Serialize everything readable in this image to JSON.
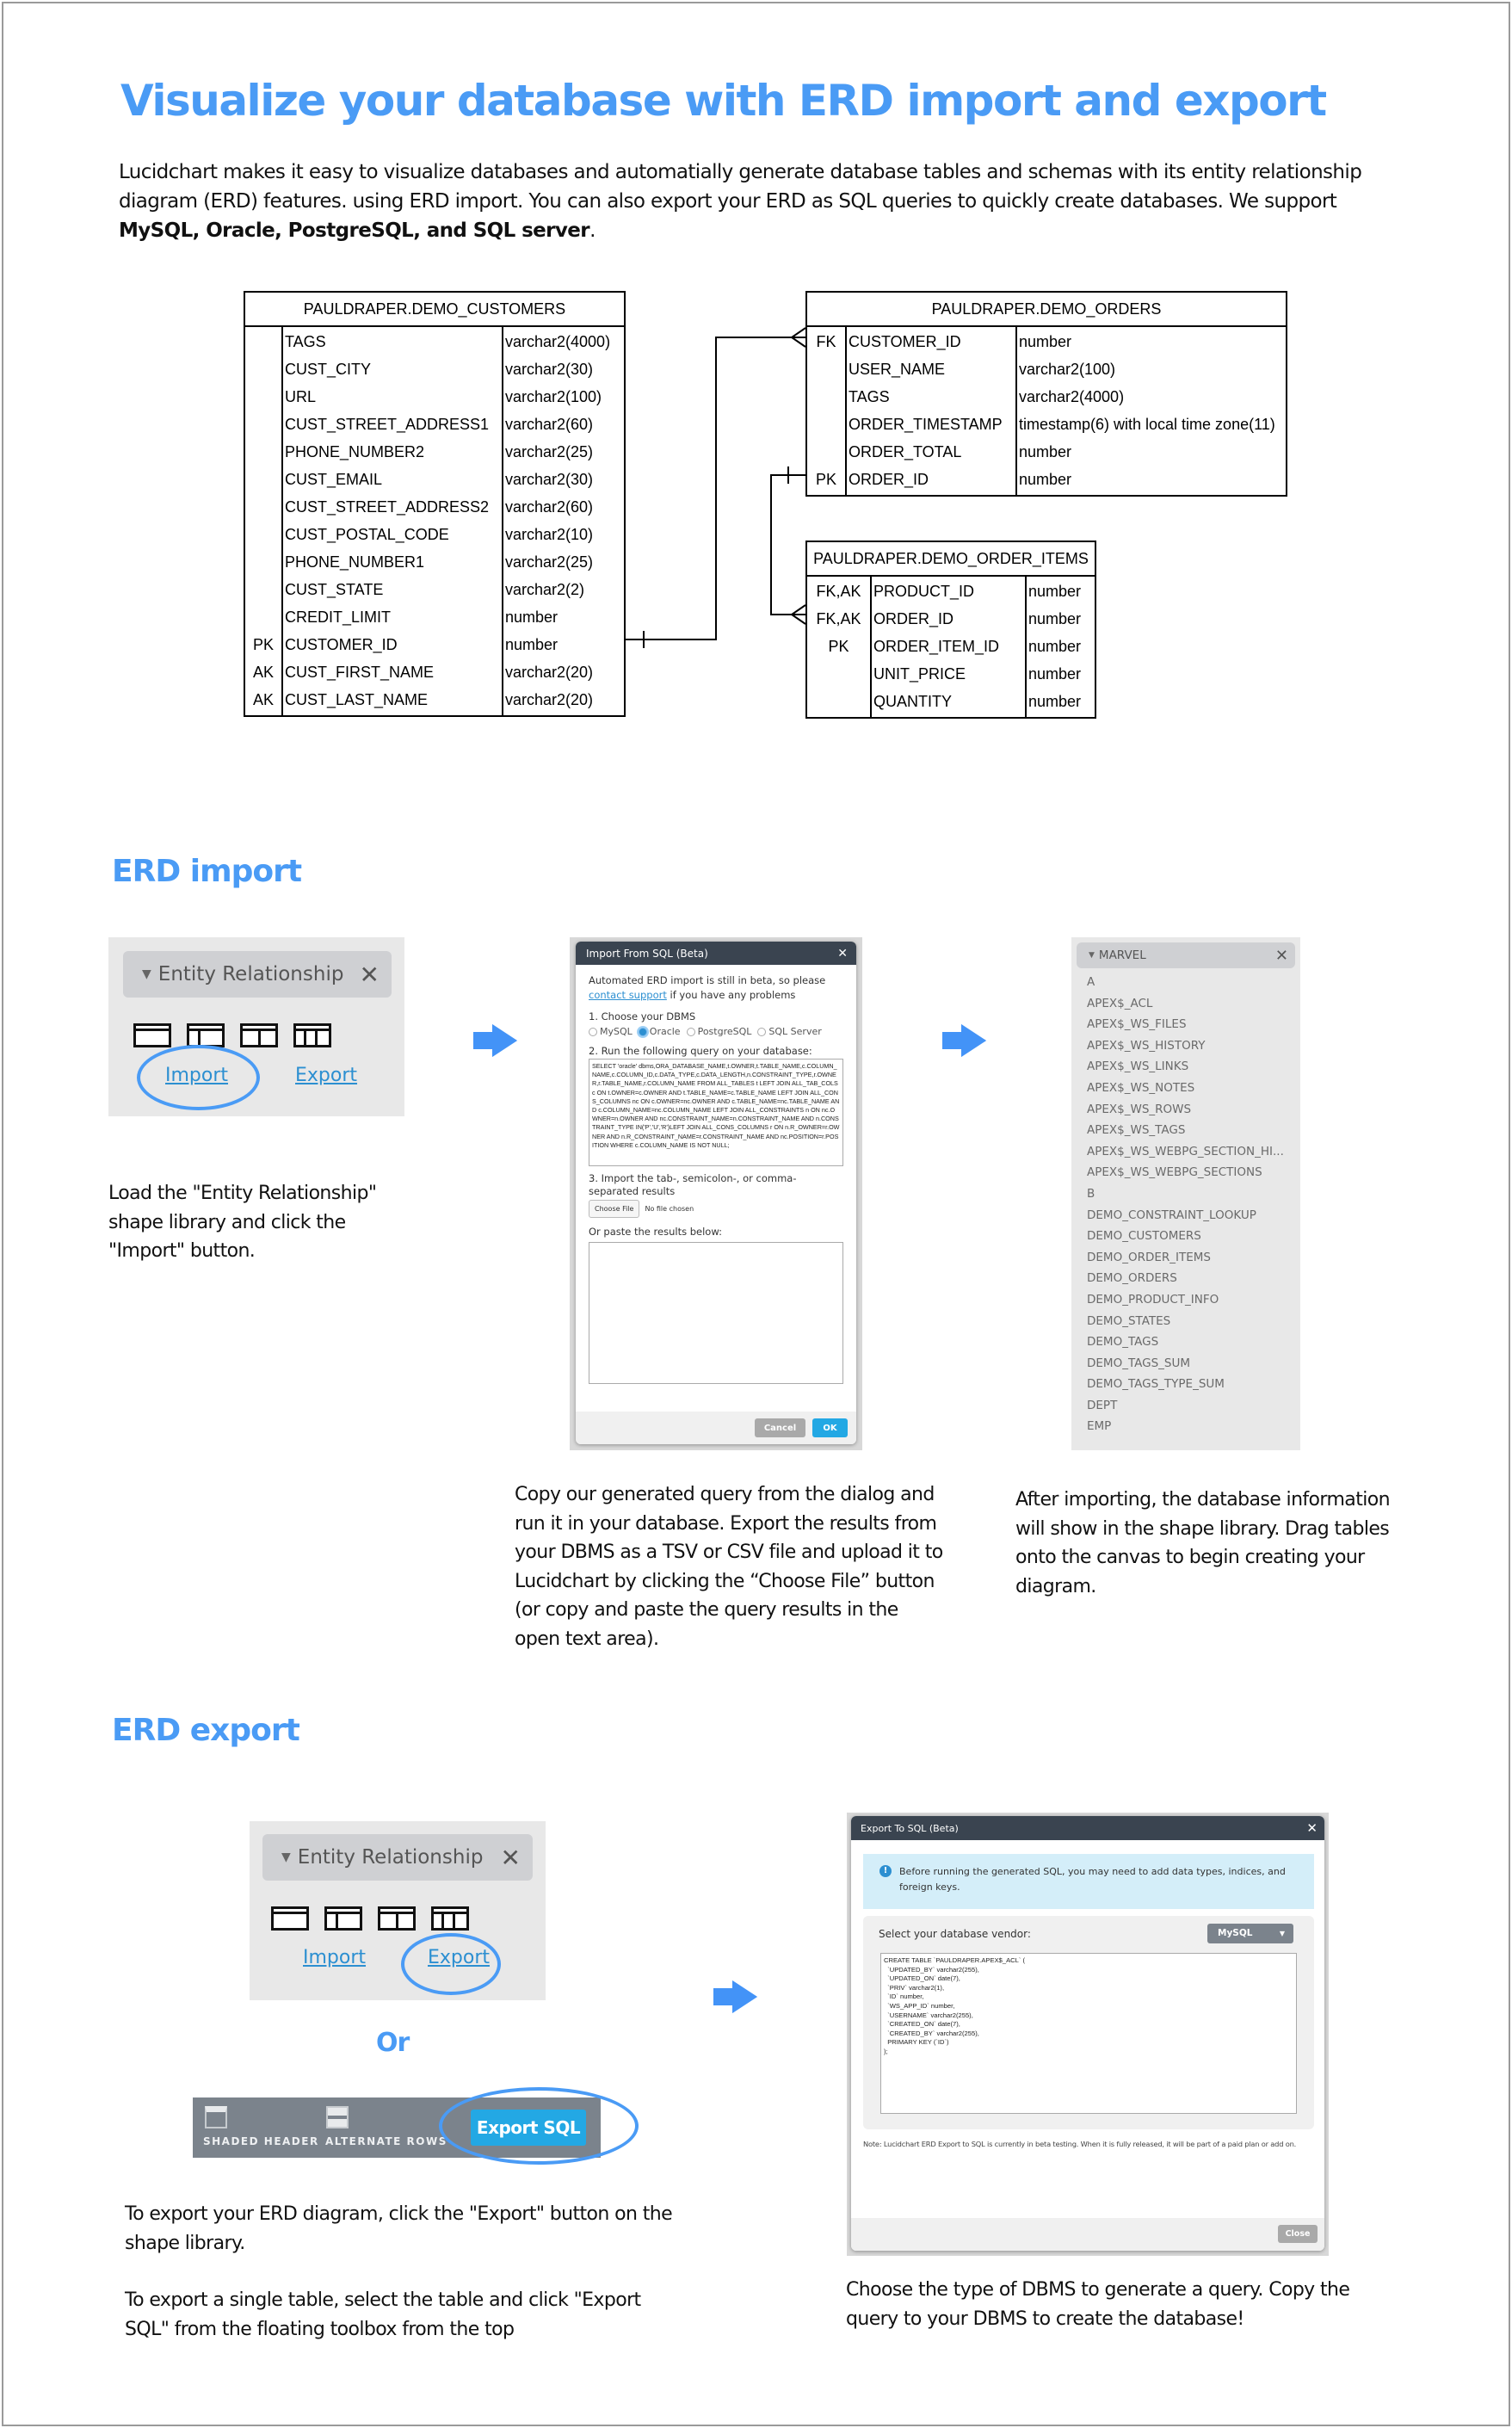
{
  "page": {
    "title": "Visualize your database with ERD import and export",
    "intro_text": "Lucidchart makes it easy to visualize databases and automatially generate database tables and schemas with its entity relationship diagram (ERD) features. using ERD import. You can also export your ERD as SQL queries to quickly create databases. We support ",
    "intro_bold": "MySQL, Oracle, PostgreSQL, and SQL server",
    "intro_end": ".",
    "accent_color": "#4a9bf5"
  },
  "erd": {
    "tables": [
      {
        "name": "PAULDRAPER.DEMO_CUSTOMERS",
        "columns": [
          {
            "key": "",
            "name": "TAGS",
            "type": "varchar2(4000)"
          },
          {
            "key": "",
            "name": "CUST_CITY",
            "type": "varchar2(30)"
          },
          {
            "key": "",
            "name": "URL",
            "type": "varchar2(100)"
          },
          {
            "key": "",
            "name": "CUST_STREET_ADDRESS1",
            "type": "varchar2(60)"
          },
          {
            "key": "",
            "name": "PHONE_NUMBER2",
            "type": "varchar2(25)"
          },
          {
            "key": "",
            "name": "CUST_EMAIL",
            "type": "varchar2(30)"
          },
          {
            "key": "",
            "name": "CUST_STREET_ADDRESS2",
            "type": "varchar2(60)"
          },
          {
            "key": "",
            "name": "CUST_POSTAL_CODE",
            "type": "varchar2(10)"
          },
          {
            "key": "",
            "name": "PHONE_NUMBER1",
            "type": "varchar2(25)"
          },
          {
            "key": "",
            "name": "CUST_STATE",
            "type": "varchar2(2)"
          },
          {
            "key": "",
            "name": "CREDIT_LIMIT",
            "type": "number"
          },
          {
            "key": "PK",
            "name": "CUSTOMER_ID",
            "type": "number"
          },
          {
            "key": "AK",
            "name": "CUST_FIRST_NAME",
            "type": "varchar2(20)"
          },
          {
            "key": "AK",
            "name": "CUST_LAST_NAME",
            "type": "varchar2(20)"
          }
        ]
      },
      {
        "name": "PAULDRAPER.DEMO_ORDERS",
        "columns": [
          {
            "key": "FK",
            "name": "CUSTOMER_ID",
            "type": "number"
          },
          {
            "key": "",
            "name": "USER_NAME",
            "type": "varchar2(100)"
          },
          {
            "key": "",
            "name": "TAGS",
            "type": "varchar2(4000)"
          },
          {
            "key": "",
            "name": "ORDER_TIMESTAMP",
            "type": "timestamp(6) with local time zone(11)"
          },
          {
            "key": "",
            "name": "ORDER_TOTAL",
            "type": "number"
          },
          {
            "key": "PK",
            "name": "ORDER_ID",
            "type": "number"
          }
        ]
      },
      {
        "name": "PAULDRAPER.DEMO_ORDER_ITEMS",
        "columns": [
          {
            "key": "FK,AK",
            "name": "PRODUCT_ID",
            "type": "number"
          },
          {
            "key": "FK,AK",
            "name": "ORDER_ID",
            "type": "number"
          },
          {
            "key": "PK",
            "name": "ORDER_ITEM_ID",
            "type": "number"
          },
          {
            "key": "",
            "name": "UNIT_PRICE",
            "type": "number"
          },
          {
            "key": "",
            "name": "QUANTITY",
            "type": "number"
          }
        ]
      }
    ],
    "relationships": [
      {
        "from": "PAULDRAPER.DEMO_CUSTOMERS.CUSTOMER_ID",
        "to": "PAULDRAPER.DEMO_ORDERS.CUSTOMER_ID",
        "from_end": "one",
        "to_end": "many"
      },
      {
        "from": "PAULDRAPER.DEMO_ORDERS.ORDER_ID",
        "to": "PAULDRAPER.DEMO_ORDER_ITEMS.ORDER_ID",
        "from_end": "one",
        "to_end": "many"
      }
    ]
  },
  "import_section": {
    "heading": "ERD import",
    "library": {
      "title": "Entity Relationship",
      "import_label": "Import",
      "export_label": "Export"
    },
    "step1_caption": "Load the \"Entity Relationship\" shape library and click the \"Import\" button.",
    "dialog": {
      "title": "Import From SQL (Beta)",
      "notice_prefix": "Automated ERD import is still in beta, so please ",
      "notice_link": "contact support",
      "notice_suffix": " if you have any problems",
      "step1": "1. Choose your DBMS",
      "dbms_options": [
        "MySQL",
        "Oracle",
        "PostgreSQL",
        "SQL Server"
      ],
      "dbms_selected": "Oracle",
      "step2": "2. Run the following query on your database:",
      "query": "SELECT 'oracle' dbms,ORA_DATABASE_NAME,t.OWNER,t.TABLE_NAME,c.COLUMN_NAME,c.COLUMN_ID,c.DATA_TYPE,c.DATA_LENGTH,n.CONSTRAINT_TYPE,r.OWNER,r.TABLE_NAME,r.COLUMN_NAME FROM ALL_TABLES t LEFT JOIN ALL_TAB_COLS c ON t.OWNER=c.OWNER AND t.TABLE_NAME=c.TABLE_NAME LEFT JOIN ALL_CONS_COLUMNS nc ON c.OWNER=nc.OWNER AND c.TABLE_NAME=nc.TABLE_NAME AND c.COLUMN_NAME=nc.COLUMN_NAME LEFT JOIN ALL_CONSTRAINTS n ON nc.OWNER=n.OWNER AND nc.CONSTRAINT_NAME=n.CONSTRAINT_NAME AND n.CONSTRAINT_TYPE IN('P','U','R')LEFT JOIN ALL_CONS_COLUMNS r ON n.R_OWNER=r.OWNER AND n.R_CONSTRAINT_NAME=r.CONSTRAINT_NAME AND nc.POSITION=r.POSITION WHERE c.COLUMN_NAME IS NOT NULL;",
      "step3": "3. Import the tab-, semicolon-, or comma-separated results",
      "choose_file_label": "Choose File",
      "no_file_text": "No file chosen",
      "paste_label": "Or paste the results below:",
      "paste_value": "",
      "cancel_label": "Cancel",
      "ok_label": "OK"
    },
    "step2_caption": "Copy our generated query from the dialog and run it in your database. Export the results from your DBMS as a TSV or CSV file and upload it to Lucidchart by clicking the “Choose File” button (or copy and paste the query results in the open text area).",
    "marvel": {
      "title": "MARVEL",
      "items": [
        "A",
        "APEX$_ACL",
        "APEX$_WS_FILES",
        "APEX$_WS_HISTORY",
        "APEX$_WS_LINKS",
        "APEX$_WS_NOTES",
        "APEX$_WS_ROWS",
        "APEX$_WS_TAGS",
        "APEX$_WS_WEBPG_SECTION_HI...",
        "APEX$_WS_WEBPG_SECTIONS",
        "B",
        "DEMO_CONSTRAINT_LOOKUP",
        "DEMO_CUSTOMERS",
        "DEMO_ORDER_ITEMS",
        "DEMO_ORDERS",
        "DEMO_PRODUCT_INFO",
        "DEMO_STATES",
        "DEMO_TAGS",
        "DEMO_TAGS_SUM",
        "DEMO_TAGS_TYPE_SUM",
        "DEPT",
        "EMP"
      ]
    },
    "step3_caption": "After importing, the database information will show in the shape library. Drag tables onto the canvas to begin creating your diagram."
  },
  "export_section": {
    "heading": "ERD export",
    "library": {
      "title": "Entity Relationship",
      "import_label": "Import",
      "export_label": "Export"
    },
    "or_label": "Or",
    "toolbar": {
      "shaded_header": "SHADED HEADER",
      "alternate_rows": "ALTERNATE ROWS",
      "export_sql": "Export SQL"
    },
    "caption1": "To export your ERD diagram, click the \"Export\" button on the shape library.",
    "caption2": "To export a single table, select the table and click \"Export SQL\" from the floating toolbox from the top",
    "dialog": {
      "title": "Export To SQL (Beta)",
      "info": "Before running the generated SQL, you may need to add data types, indices, and foreign keys.",
      "vendor_label": "Select your database vendor:",
      "vendor_selected": "MySQL",
      "sql": "CREATE TABLE `PAULDRAPER.APEX$_ACL` (\n  `UPDATED_BY` varchar2(255),\n  `UPDATED_ON` date(7),\n  `PRIV` varchar2(1),\n  `ID` number,\n  `WS_APP_ID` number,\n  `USERNAME` varchar2(255),\n  `CREATED_ON` date(7),\n  `CREATED_BY` varchar2(255),\n  PRIMARY KEY (`ID`)\n);",
      "note": "Note: Lucidchart ERD Export to SQL is currently in beta testing. When it is fully released, it will be part of a paid plan or add on.",
      "close_label": "Close"
    },
    "caption3": "Choose the type of DBMS to generate a query. Copy the query to your DBMS to create the database!"
  }
}
